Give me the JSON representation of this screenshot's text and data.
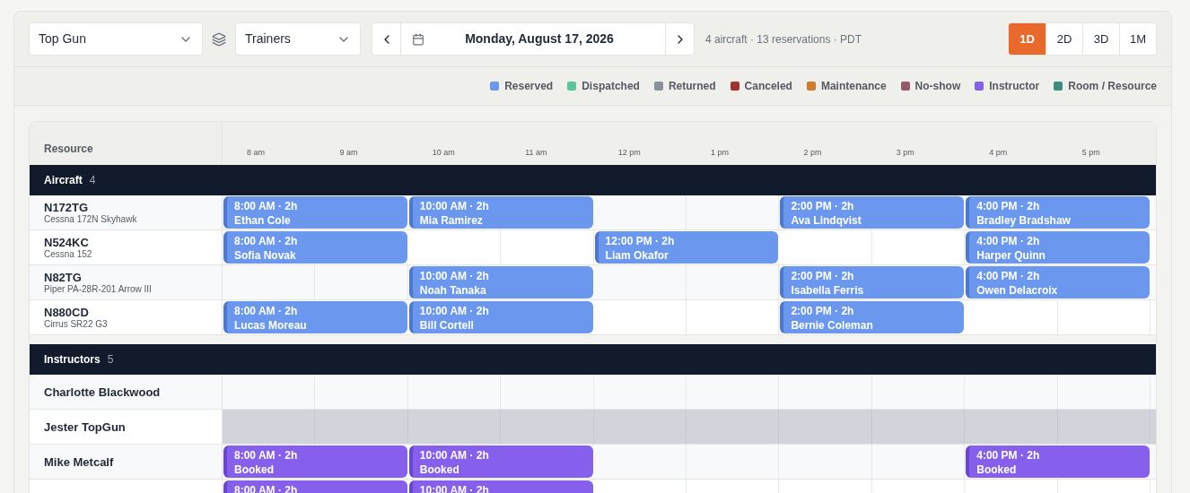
{
  "toolbar": {
    "location": "Top Gun",
    "group": "Trainers",
    "date": "Monday, August 17, 2026",
    "summary": "4 aircraft · 13 reservations · PDT",
    "views": [
      {
        "label": "1D",
        "selected": true
      },
      {
        "label": "2D",
        "selected": false
      },
      {
        "label": "3D",
        "selected": false
      },
      {
        "label": "1M",
        "selected": false
      }
    ]
  },
  "legend": [
    {
      "label": "Reserved",
      "color": "#6b98ee"
    },
    {
      "label": "Dispatched",
      "color": "#5fc499"
    },
    {
      "label": "Returned",
      "color": "#8a909c"
    },
    {
      "label": "Canceled",
      "color": "#a23232"
    },
    {
      "label": "Maintenance",
      "color": "#d17a2b"
    },
    {
      "label": "No-show",
      "color": "#94596f"
    },
    {
      "label": "Instructor",
      "color": "#8660ec"
    },
    {
      "label": "Room / Resource",
      "color": "#3a8b80"
    }
  ],
  "schedule": {
    "resource_heading": "Resource",
    "hours": [
      "8 am",
      "9 am",
      "10 am",
      "11 am",
      "12 pm",
      "1 pm",
      "2 pm",
      "3 pm",
      "4 pm",
      "5 pm"
    ],
    "sections": [
      {
        "title": "Aircraft",
        "count": "4",
        "rows": [
          {
            "name": "N172TG",
            "model": "Cessna 172N Skyhawk",
            "unavailable": false,
            "lane": [
              {
                "kind": "reserved",
                "time": "8:00 AM · 2h",
                "name": "Ethan Cole"
              },
              {
                "kind": "reserved",
                "time": "10:00 AM · 2h",
                "name": "Mia Ramirez"
              },
              {
                "kind": "empty"
              },
              {
                "kind": "empty"
              },
              {
                "kind": "reserved",
                "time": "2:00 PM · 2h",
                "name": "Ava Lindqvist"
              },
              {
                "kind": "reserved",
                "time": "4:00 PM · 2h",
                "name": "Bradley Bradshaw"
              }
            ]
          },
          {
            "name": "N524KC",
            "model": "Cessna 152",
            "unavailable": false,
            "lane": [
              {
                "kind": "reserved",
                "time": "8:00 AM · 2h",
                "name": "Sofia Novak"
              },
              {
                "kind": "empty"
              },
              {
                "kind": "empty"
              },
              {
                "kind": "reserved",
                "time": "12:00 PM · 2h",
                "name": "Liam Okafor"
              },
              {
                "kind": "empty"
              },
              {
                "kind": "empty"
              },
              {
                "kind": "reserved",
                "time": "4:00 PM · 2h",
                "name": "Harper Quinn"
              }
            ]
          },
          {
            "name": "N82TG",
            "model": "Piper PA-28R-201 Arrow III",
            "unavailable": false,
            "lane": [
              {
                "kind": "empty"
              },
              {
                "kind": "empty"
              },
              {
                "kind": "reserved",
                "time": "10:00 AM · 2h",
                "name": "Noah Tanaka"
              },
              {
                "kind": "empty"
              },
              {
                "kind": "empty"
              },
              {
                "kind": "reserved",
                "time": "2:00 PM · 2h",
                "name": "Isabella Ferris"
              },
              {
                "kind": "reserved",
                "time": "4:00 PM · 2h",
                "name": "Owen Delacroix"
              }
            ]
          },
          {
            "name": "N880CD",
            "model": "Cirrus SR22 G3",
            "unavailable": false,
            "lane": [
              {
                "kind": "reserved",
                "time": "8:00 AM · 2h",
                "name": "Lucas Moreau"
              },
              {
                "kind": "reserved",
                "time": "10:00 AM · 2h",
                "name": "Bill Cortell"
              },
              {
                "kind": "empty"
              },
              {
                "kind": "empty"
              },
              {
                "kind": "reserved",
                "time": "2:00 PM · 2h",
                "name": "Bernie Coleman"
              },
              {
                "kind": "empty"
              },
              {
                "kind": "empty"
              }
            ]
          }
        ]
      },
      {
        "title": "Instructors",
        "count": "5",
        "rows": [
          {
            "name": "Charlotte Blackwood",
            "unavailable": false,
            "lane": [
              {
                "kind": "empty"
              },
              {
                "kind": "empty"
              },
              {
                "kind": "empty"
              },
              {
                "kind": "empty"
              },
              {
                "kind": "empty"
              },
              {
                "kind": "empty"
              },
              {
                "kind": "empty"
              },
              {
                "kind": "empty"
              },
              {
                "kind": "empty"
              },
              {
                "kind": "empty"
              }
            ]
          },
          {
            "name": "Jester TopGun",
            "unavailable": true,
            "lane": [
              {
                "kind": "empty"
              },
              {
                "kind": "empty"
              },
              {
                "kind": "empty"
              },
              {
                "kind": "empty"
              },
              {
                "kind": "empty"
              },
              {
                "kind": "empty"
              },
              {
                "kind": "empty"
              },
              {
                "kind": "empty"
              },
              {
                "kind": "empty"
              },
              {
                "kind": "empty"
              }
            ]
          },
          {
            "name": "Mike Metcalf",
            "unavailable": false,
            "lane": [
              {
                "kind": "instructor",
                "time": "8:00 AM · 2h",
                "name": "Booked"
              },
              {
                "kind": "instructor",
                "time": "10:00 AM · 2h",
                "name": "Booked"
              },
              {
                "kind": "empty"
              },
              {
                "kind": "empty"
              },
              {
                "kind": "empty"
              },
              {
                "kind": "empty"
              },
              {
                "kind": "instructor",
                "time": "4:00 PM · 2h",
                "name": "Booked"
              }
            ]
          },
          {
            "unavailable": false,
            "lane": [
              {
                "kind": "instructor",
                "time": "8:00 AM · 2h"
              },
              {
                "kind": "instructor",
                "time": "10:00 AM · 2h"
              },
              {
                "kind": "empty"
              },
              {
                "kind": "empty"
              },
              {
                "kind": "empty"
              },
              {
                "kind": "empty"
              },
              {
                "kind": "empty"
              },
              {
                "kind": "empty"
              }
            ]
          }
        ]
      }
    ]
  }
}
